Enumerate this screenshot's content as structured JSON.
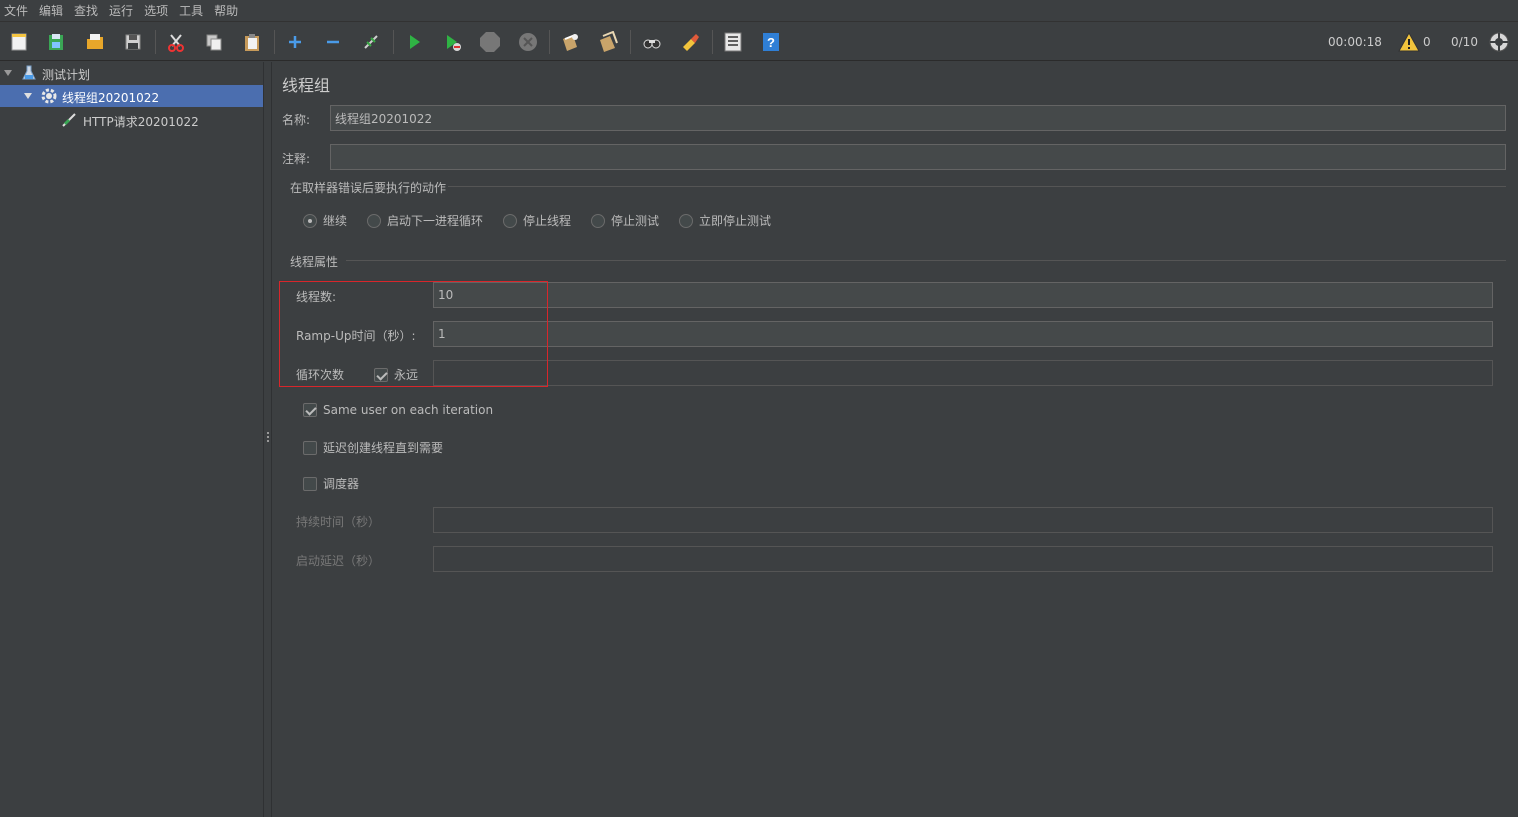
{
  "menu": [
    "文件",
    "编辑",
    "查找",
    "运行",
    "选项",
    "工具",
    "帮助"
  ],
  "toolbar": {
    "timer": "00:00:18",
    "warning_count": "0",
    "threads": "0/10",
    "icons": [
      "new-icon",
      "templates-icon",
      "open-icon",
      "save-icon",
      "cut-icon",
      "copy-icon",
      "paste-icon",
      "expand-icon",
      "collapse-icon",
      "toggle-icon",
      "start-icon",
      "start-no-pause-icon",
      "stop-icon",
      "shutdown-icon",
      "clear-icon",
      "clear-all-icon",
      "search-icon",
      "reset-search-icon",
      "function-helper-icon",
      "help-icon",
      "warning-icon",
      "remote-icon"
    ]
  },
  "tree": {
    "items": [
      {
        "label": "测试计划",
        "icon": "test-plan-icon"
      },
      {
        "label": "线程组20201022",
        "icon": "thread-group-icon"
      },
      {
        "label": "HTTP请求20201022",
        "icon": "sampler-icon"
      }
    ]
  },
  "panel": {
    "title": "线程组",
    "name_label": "名称:",
    "name_value": "线程组20201022",
    "comment_label": "注释:",
    "comment_value": "",
    "error_group_title": "在取样器错误后要执行的动作",
    "error_options": [
      "继续",
      "启动下一进程循环",
      "停止线程",
      "停止测试",
      "立即停止测试"
    ],
    "error_selected": "继续",
    "props_group_title": "线程属性",
    "threads_label": "线程数:",
    "threads_value": "10",
    "rampup_label": "Ramp-Up时间（秒）:",
    "rampup_value": "1",
    "loop_label": "循环次数",
    "forever_label": "永远",
    "forever_checked": true,
    "loop_value": "",
    "same_user_label": "Same user on each iteration",
    "same_user_checked": true,
    "delay_label": "延迟创建线程直到需要",
    "delay_checked": false,
    "scheduler_label": "调度器",
    "scheduler_checked": false,
    "duration_label": "持续时间（秒）",
    "duration_value": "",
    "startup_delay_label": "启动延迟（秒）",
    "startup_delay_value": ""
  }
}
